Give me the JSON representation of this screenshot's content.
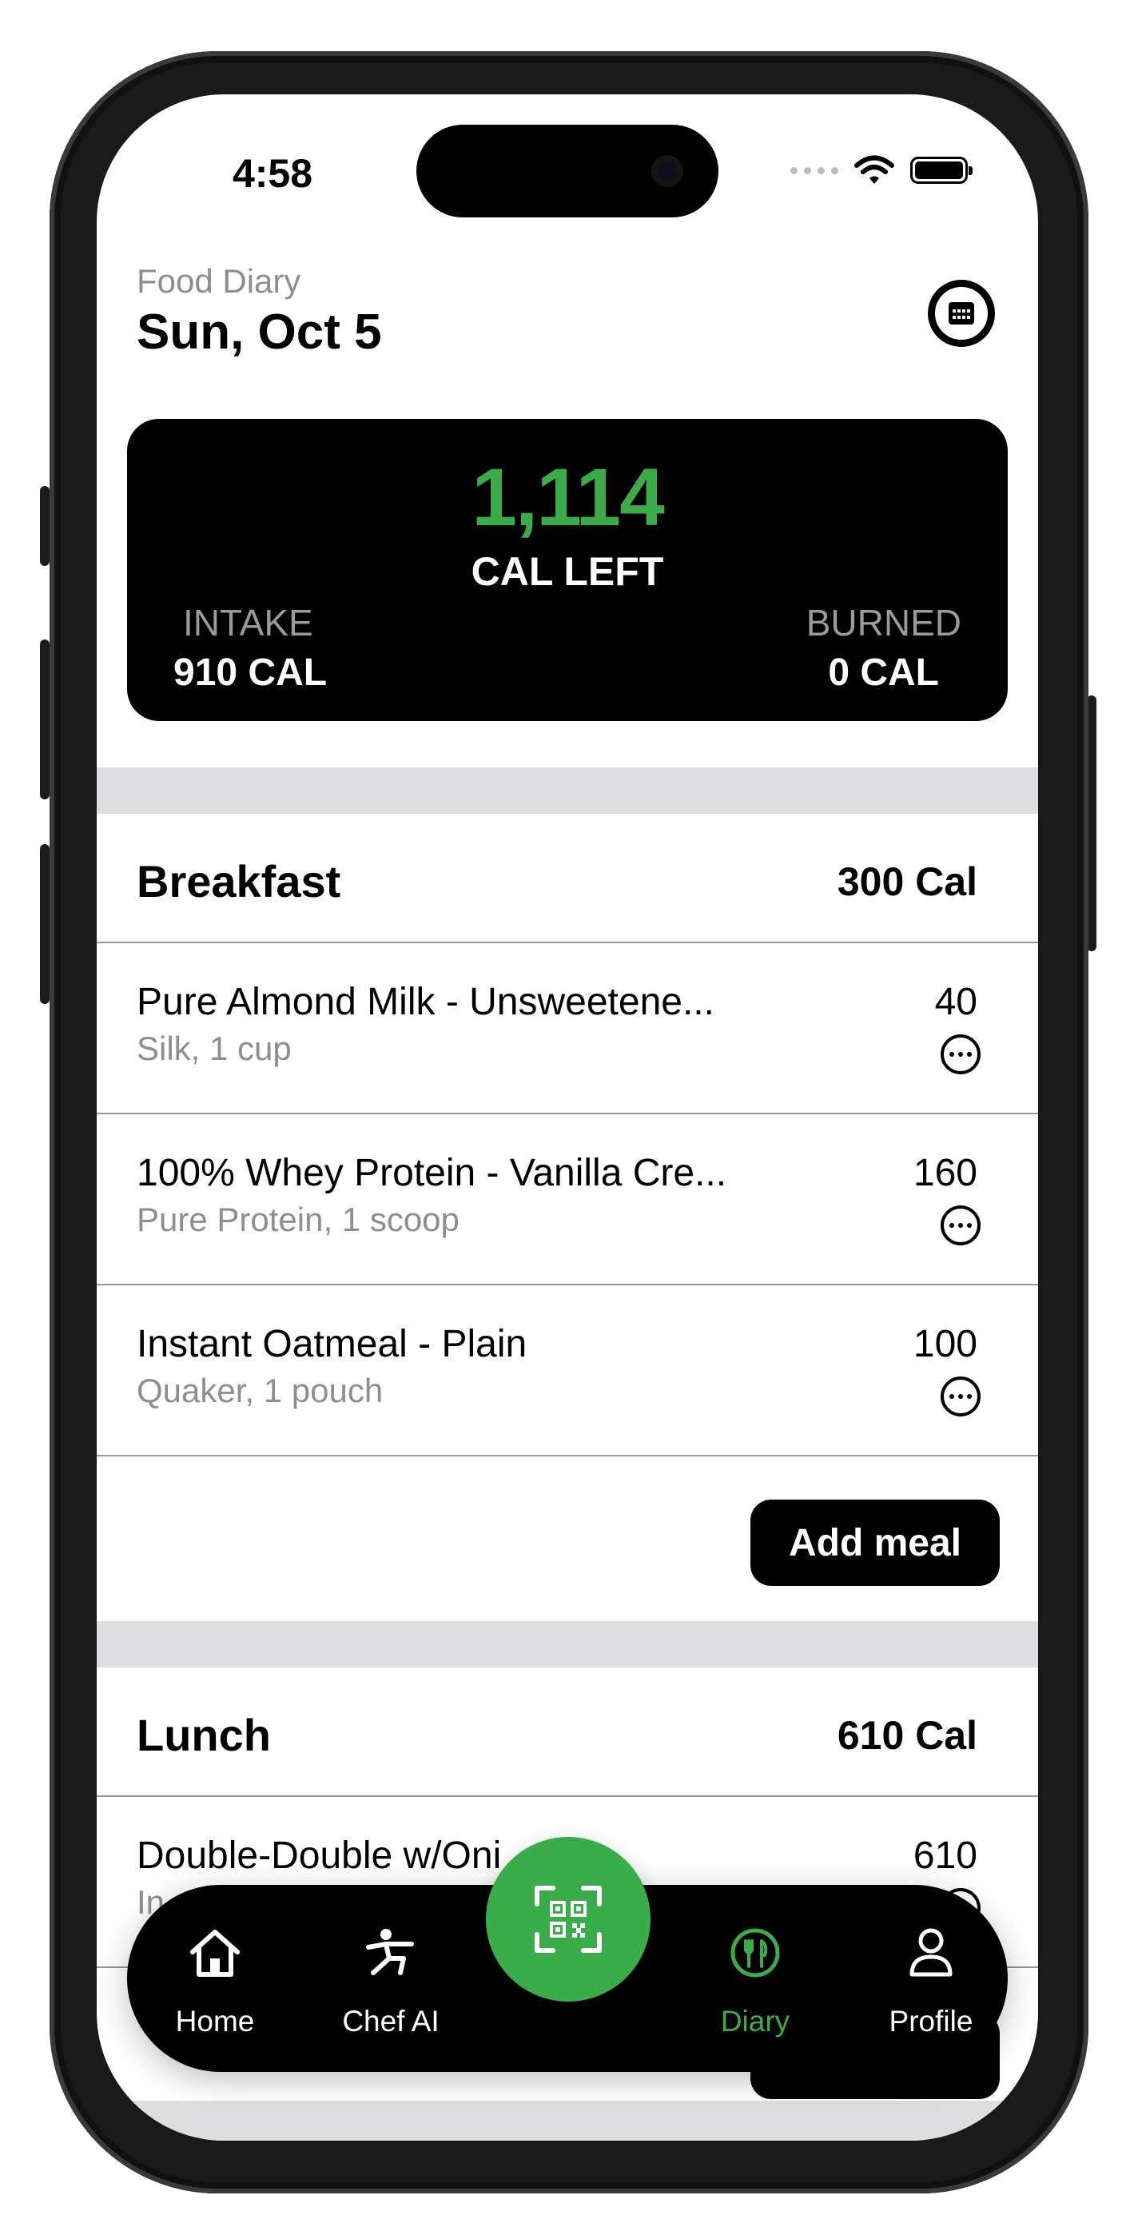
{
  "status_bar": {
    "time": "4:58"
  },
  "header": {
    "subtitle": "Food Diary",
    "date": "Sun, Oct 5"
  },
  "summary": {
    "calories_left": "1,114",
    "calories_left_label": "CAL LEFT",
    "intake_label": "INTAKE",
    "intake_value": "910 CAL",
    "burned_label": "BURNED",
    "burned_value": "0 CAL"
  },
  "meals": [
    {
      "name": "Breakfast",
      "calories": "300 Cal",
      "items": [
        {
          "name": "Pure Almond Milk - Unsweetene...",
          "detail": "Silk, 1 cup",
          "calories": "40"
        },
        {
          "name": "100% Whey Protein - Vanilla Cre...",
          "detail": "Pure Protein, 1 scoop",
          "calories": "160"
        },
        {
          "name": "Instant Oatmeal - Plain",
          "detail": "Quaker, 1 pouch",
          "calories": "100"
        }
      ],
      "add_label": "Add meal"
    },
    {
      "name": "Lunch",
      "calories": "610 Cal",
      "items": [
        {
          "name": "Double-Double w/Oni",
          "detail": "In",
          "calories": "610"
        }
      ]
    }
  ],
  "tabbar": {
    "tabs": [
      {
        "label": "Home",
        "icon": "house-icon"
      },
      {
        "label": "Chef AI",
        "icon": "person-kick-icon"
      },
      {
        "label": "Diary",
        "icon": "fork-knife-icon",
        "active": true
      },
      {
        "label": "Profile",
        "icon": "person-icon"
      }
    ],
    "center_icon": "qr-scan-icon"
  },
  "colors": {
    "accent": "#3aad4a",
    "card": "#000000",
    "muted": "#8e8e8e"
  }
}
